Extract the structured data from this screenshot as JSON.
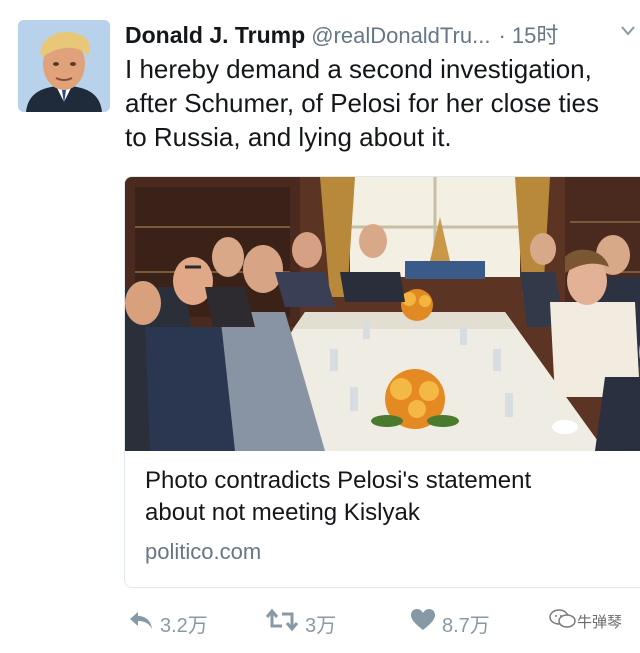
{
  "tweet": {
    "author_name": "Donald J. Trump",
    "handle": "@realDonaldTru...",
    "time": "· 15时",
    "text_lines": [
      "I hereby demand a second investigation,",
      "after Schumer, of Pelosi for her close ties",
      "to Russia, and lying about it."
    ],
    "avatar_icon": "trump-portrait",
    "more_icon": "chevron-down-icon"
  },
  "card": {
    "title_lines": [
      "Photo contradicts Pelosi's statement",
      "about not meeting Kislyak"
    ],
    "domain": "politico.com",
    "image_icon": "meeting-photo"
  },
  "actions": {
    "reply": {
      "icon": "reply-icon",
      "count": "3.2万"
    },
    "retweet": {
      "icon": "retweet-icon",
      "count": "3万"
    },
    "like": {
      "icon": "heart-icon",
      "count": "8.7万"
    }
  },
  "watermark": {
    "text": "牛弹琴",
    "icon": "wechat-icon"
  },
  "colors": {
    "text": "#14171a",
    "secondary": "#657786",
    "action": "#8899a6",
    "border": "#e1e8ed"
  }
}
